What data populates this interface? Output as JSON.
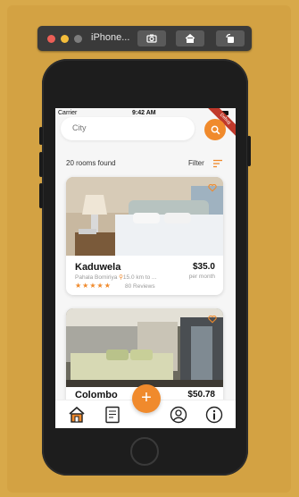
{
  "simulator": {
    "title": "iPhone..."
  },
  "status": {
    "carrier": "Carrier",
    "time": "9:42 AM"
  },
  "ribbon": "Debug",
  "search": {
    "placeholder": "City",
    "value": ""
  },
  "results": {
    "count_text": "20 rooms found",
    "filter_label": "Filter"
  },
  "colors": {
    "accent": "#f08a2c",
    "background": "#d8a94a"
  },
  "rooms": [
    {
      "title": "Kaduwela",
      "price": "$35.0",
      "price_unit": "per month",
      "location": "Pahala Bomiriya",
      "distance": "15.0 km to ...",
      "rating": 4.5,
      "stars": "★★★★★",
      "reviews": "80 Reviews"
    },
    {
      "title": "Colombo",
      "price": "$50.78"
    }
  ],
  "nav": {
    "items": [
      "home-icon",
      "document-icon",
      "add-icon",
      "user-icon",
      "info-icon"
    ],
    "fab_label": "+"
  }
}
